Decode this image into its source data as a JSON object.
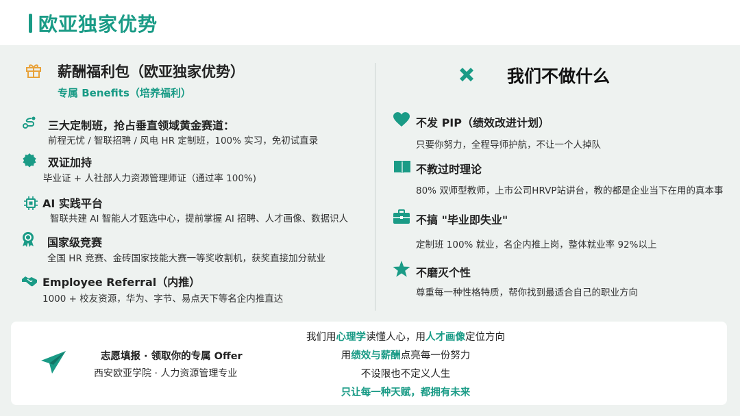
{
  "header": {
    "title": "欧亚独家优势"
  },
  "left": {
    "heading": "薪酬福利包（欧亚独家优势）",
    "subheading": "专属 Benefits（培养福利）",
    "items": [
      {
        "icon": "route-icon",
        "title": "三大定制班，抢占垂直领域黄金赛道：",
        "desc": "前程无忧 / 智联招聘 / 风电 HR 定制班，100% 实习，免初试直录"
      },
      {
        "icon": "certificate-seal-icon",
        "title": "双证加持",
        "desc": "毕业证 + 人社部人力资源管理师证（通过率 100%)"
      },
      {
        "icon": "chip-icon",
        "title": "AI 实践平台",
        "desc": "智联共建 AI 智能人才甄选中心，提前掌握 AI 招聘、人才画像、数据识人"
      },
      {
        "icon": "award-icon",
        "title": "国家级竞赛",
        "desc": "全国 HR 竞赛、金砖国家技能大赛一等奖收割机，获奖直接加分就业"
      },
      {
        "icon": "handshake-icon",
        "title": "Employee  Referral（内推）",
        "desc": "1000 + 校友资源，华为、字节、易点天下等名企内推直达"
      }
    ]
  },
  "right": {
    "heading": "我们不做什么",
    "items": [
      {
        "icon": "heart-icon",
        "title": "不发 PIP（绩效改进计划）",
        "desc": "只要你努力，全程导师护航，不让一个人掉队"
      },
      {
        "icon": "book-icon",
        "title": "不教过时理论",
        "desc": "80% 双师型教师，上市公司HRVP站讲台，教的都是企业当下在用的真本事"
      },
      {
        "icon": "briefcase-icon",
        "title": "不搞 \"毕业即失业\"",
        "desc": "定制班 100% 就业，名企内推上岗，整体就业率 92%以上"
      },
      {
        "icon": "star-icon",
        "title": "不磨灭个性",
        "desc": "尊重每一种性格特质，帮你找到最适合自己的职业方向"
      }
    ]
  },
  "bottom": {
    "title": "志愿填报 · 领取你的专属 Offer",
    "subtitle": "西安欧亚学院 · 人力资源管理专业",
    "lines": [
      {
        "pre": "我们用",
        "hl": "心理学",
        "mid": "读懂人心，用",
        "hl2": "人才画像",
        "post": "定位方向"
      },
      {
        "pre": "用",
        "hl": "绩效与薪酬",
        "mid": "点亮每一份努力",
        "hl2": "",
        "post": ""
      },
      {
        "pre": "不设限也不定义人生",
        "hl": "",
        "mid": "",
        "hl2": "",
        "post": ""
      }
    ],
    "final": "只让每一种天赋，都拥有未来"
  },
  "colors": {
    "accent": "#1a9b86",
    "gift": "#e8a23a"
  }
}
